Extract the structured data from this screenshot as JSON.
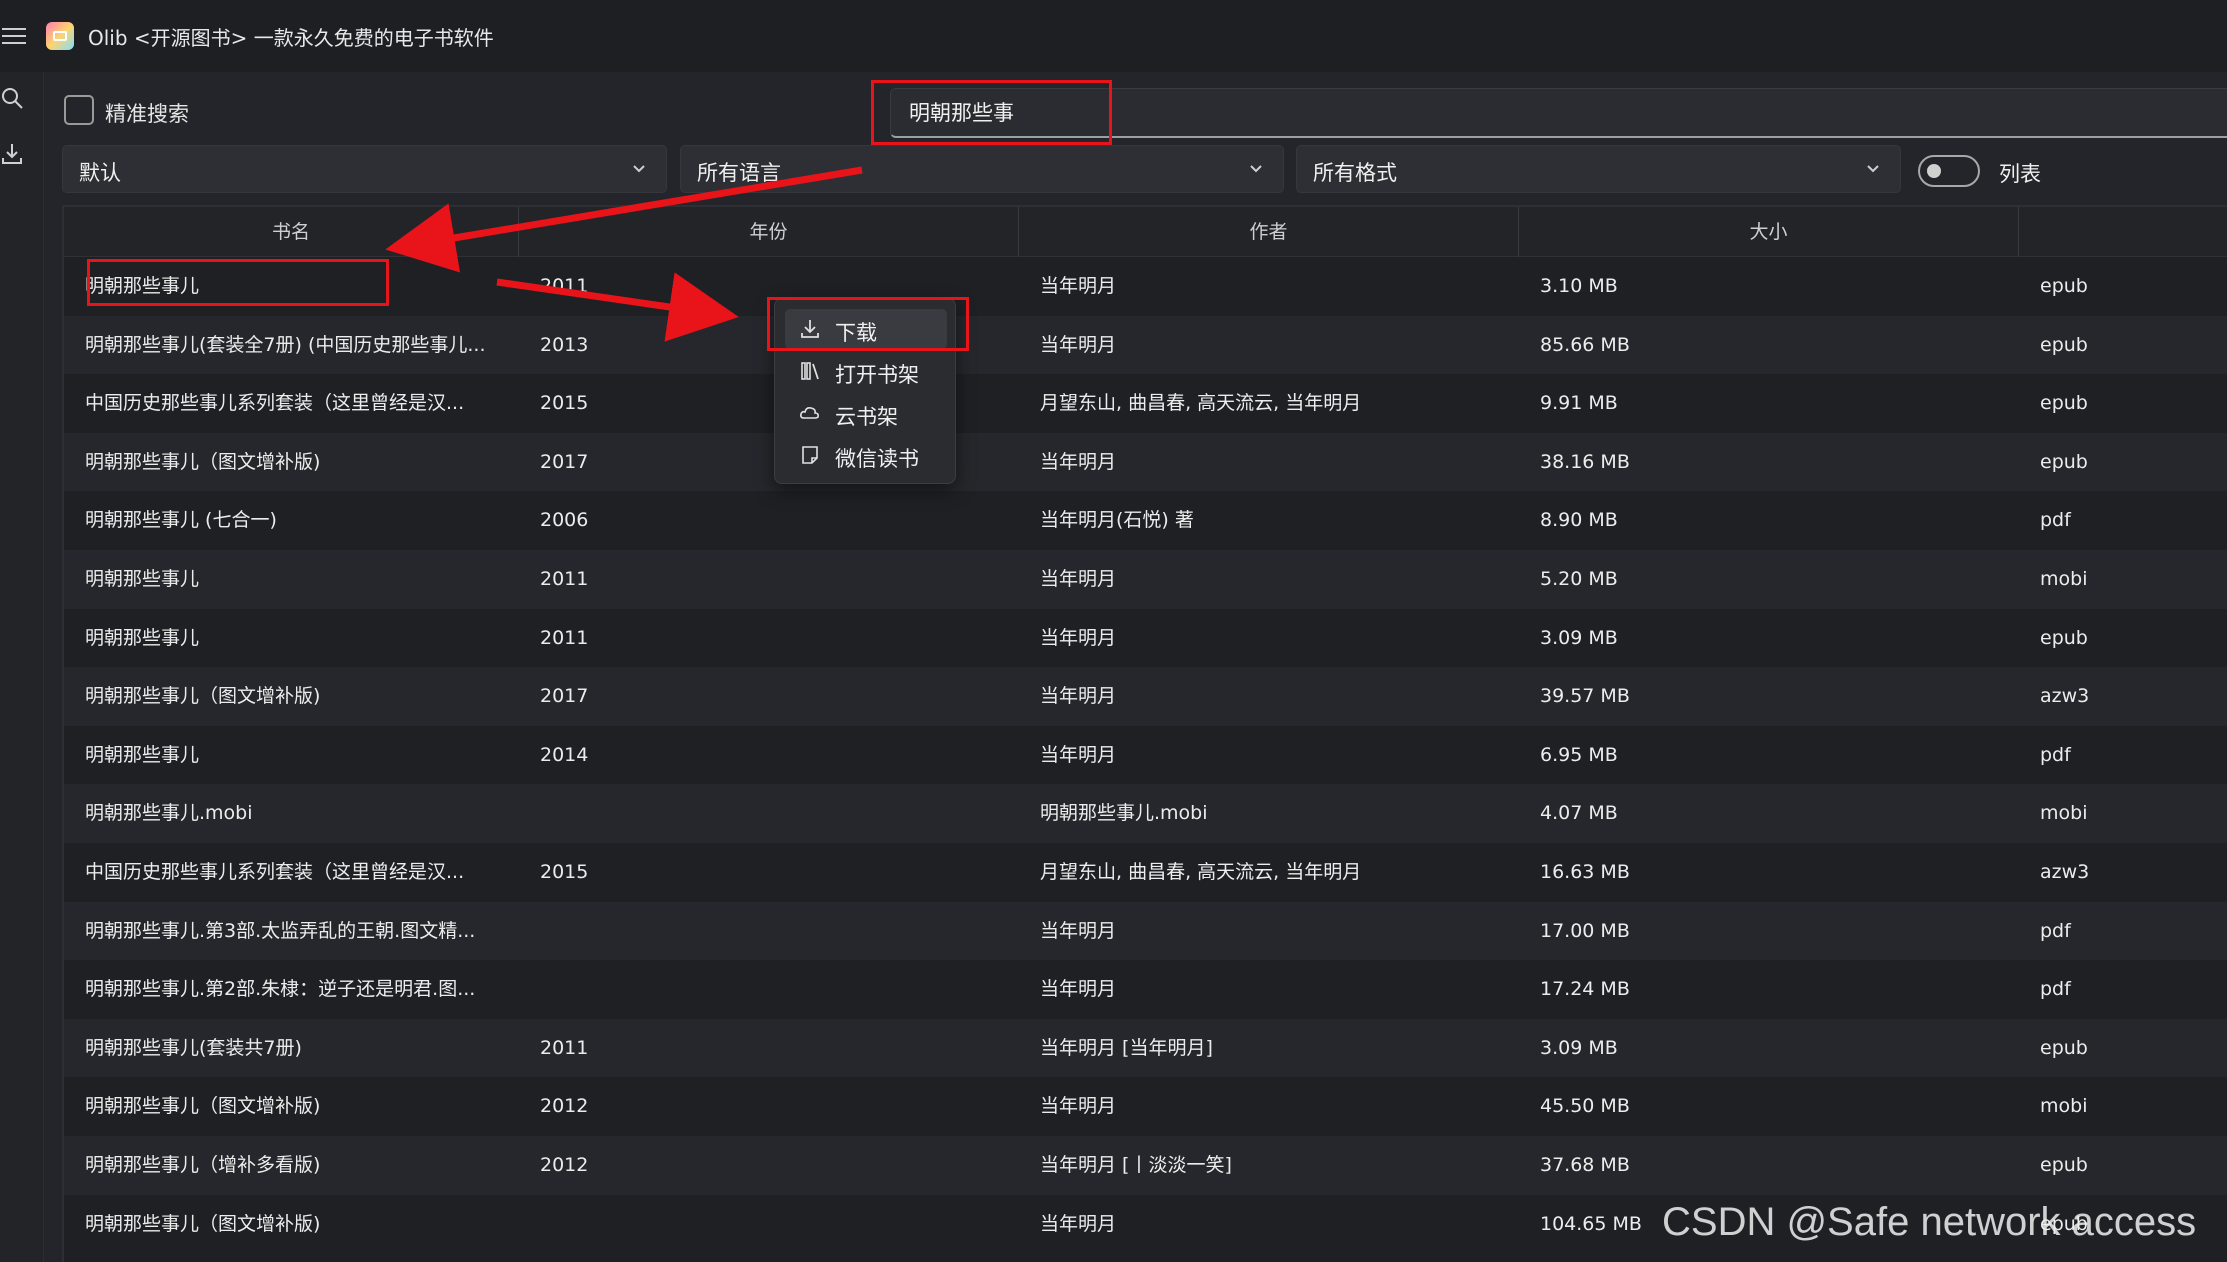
{
  "window": {
    "title": "Olib <开源图书> 一款永久免费的电子书软件"
  },
  "leftbar": {
    "icons": [
      "search-icon",
      "download-icon"
    ]
  },
  "search": {
    "exact_label": "精准搜索",
    "exact_checked": false,
    "query": "明朝那些事"
  },
  "filters": {
    "sort": "默认",
    "language": "所有语言",
    "format": "所有格式",
    "list_label": "列表",
    "list_toggle_on": false
  },
  "table": {
    "headers": [
      "书名",
      "年份",
      "作者",
      "大小"
    ],
    "rows": [
      {
        "title": "明朝那些事儿",
        "year": "2011",
        "author": "当年明月",
        "size": "3.10 MB",
        "format": "epub"
      },
      {
        "title": "明朝那些事儿(套装全7册) (中国历史那些事儿...",
        "year": "2013",
        "author": "当年明月",
        "size": "85.66 MB",
        "format": "epub"
      },
      {
        "title": "中国历史那些事儿系列套装（这里曾经是汉...",
        "year": "2015",
        "author": "月望东山, 曲昌春, 高天流云, 当年明月",
        "size": "9.91 MB",
        "format": "epub"
      },
      {
        "title": "明朝那些事儿（图文增补版)",
        "year": "2017",
        "author": "当年明月",
        "size": "38.16 MB",
        "format": "epub"
      },
      {
        "title": "明朝那些事儿 (七合一)",
        "year": "2006",
        "author": "当年明月(石悦) 著",
        "size": "8.90 MB",
        "format": "pdf"
      },
      {
        "title": "明朝那些事儿",
        "year": "2011",
        "author": "当年明月",
        "size": "5.20 MB",
        "format": "mobi"
      },
      {
        "title": "明朝那些事儿",
        "year": "2011",
        "author": "当年明月",
        "size": "3.09 MB",
        "format": "epub"
      },
      {
        "title": "明朝那些事儿（图文增补版)",
        "year": "2017",
        "author": "当年明月",
        "size": "39.57 MB",
        "format": "azw3"
      },
      {
        "title": "明朝那些事儿",
        "year": "2014",
        "author": "当年明月",
        "size": "6.95 MB",
        "format": "pdf"
      },
      {
        "title": "明朝那些事儿.mobi",
        "year": "",
        "author": "明朝那些事儿.mobi",
        "size": "4.07 MB",
        "format": "mobi"
      },
      {
        "title": "中国历史那些事儿系列套装（这里曾经是汉...",
        "year": "2015",
        "author": "月望东山, 曲昌春, 高天流云, 当年明月",
        "size": "16.63 MB",
        "format": "azw3"
      },
      {
        "title": "明朝那些事儿.第3部.太监弄乱的王朝.图文精...",
        "year": "",
        "author": "当年明月",
        "size": "17.00 MB",
        "format": "pdf"
      },
      {
        "title": "明朝那些事儿.第2部.朱棣：逆子还是明君.图...",
        "year": "",
        "author": "当年明月",
        "size": "17.24 MB",
        "format": "pdf"
      },
      {
        "title": "明朝那些事儿(套装共7册)",
        "year": "2011",
        "author": "当年明月 [当年明月]",
        "size": "3.09 MB",
        "format": "epub"
      },
      {
        "title": "明朝那些事儿（图文增补版)",
        "year": "2012",
        "author": "当年明月",
        "size": "45.50 MB",
        "format": "mobi"
      },
      {
        "title": "明朝那些事儿（增补多看版)",
        "year": "2012",
        "author": "当年明月 [丨淡淡一笑]",
        "size": "37.68 MB",
        "format": "epub"
      },
      {
        "title": "明朝那些事儿（图文增补版)",
        "year": "",
        "author": "当年明月",
        "size": "104.65 MB",
        "format": "epub"
      }
    ]
  },
  "context_menu": {
    "items": [
      {
        "label": "下载",
        "icon": "download-icon",
        "active": true
      },
      {
        "label": "打开书架",
        "icon": "bookshelf-icon",
        "active": false
      },
      {
        "label": "云书架",
        "icon": "cloud-icon",
        "active": false
      },
      {
        "label": "微信读书",
        "icon": "note-icon",
        "active": false
      }
    ]
  },
  "annotations": {
    "color": "#e8141a"
  },
  "watermark": "CSDN @Safe network access"
}
